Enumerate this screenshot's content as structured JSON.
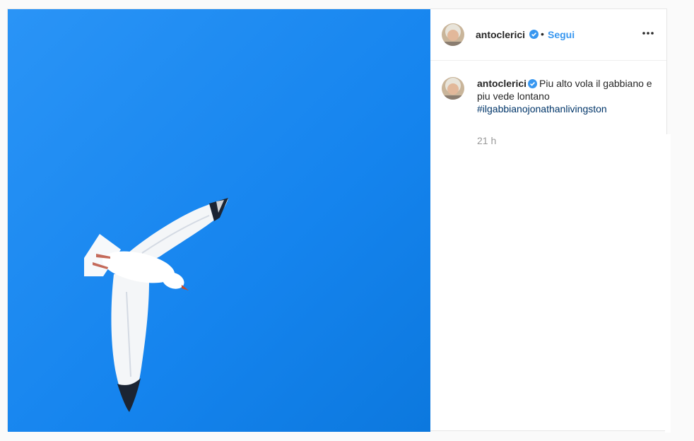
{
  "post": {
    "author": {
      "username": "antoclerici",
      "verified_icon": "verified-badge-icon",
      "follow_separator": "•",
      "follow_label": "Segui"
    },
    "menu_icon": "more-options-icon",
    "caption": {
      "username": "antoclerici",
      "text": "Piu alto vola il gabbiano e piu vede lontano",
      "hashtag": "#ilgabbianojonathanlivingston"
    },
    "timestamp": "21 h",
    "photo_subject": "seagull in flight against blue sky"
  },
  "colors": {
    "sky_top": "#1e8ff5",
    "sky_bottom": "#0a78e0",
    "follow_blue": "#3897f0",
    "hashtag_blue": "#003569",
    "verified_blue": "#3897f0",
    "text": "#262626",
    "muted": "#999999"
  }
}
